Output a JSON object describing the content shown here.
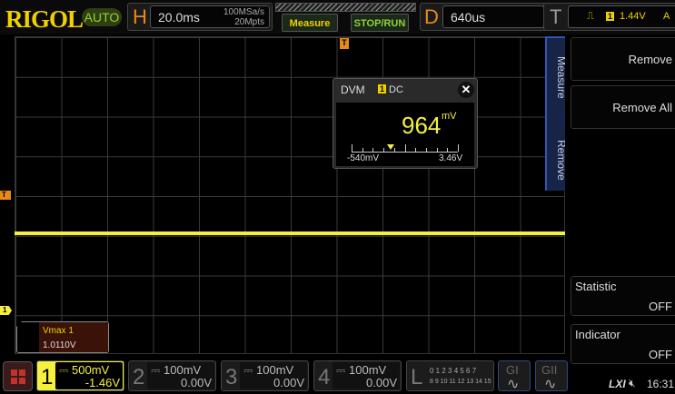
{
  "header": {
    "logo": "RIGOL",
    "mode": "AUTO",
    "h_label": "H",
    "timebase": "20.0ms",
    "sample_rate": "100MSa/s",
    "memory_depth": "20Mpts",
    "measure_button": "Measure",
    "stop_run_button": "STOP/RUN",
    "d_label": "D",
    "delay": "640us",
    "t_label": "T",
    "trigger_channel": "1",
    "trigger_level": "1.44V",
    "trigger_mode": "A"
  },
  "markers": {
    "trigger_pos": "T",
    "trigger_level": "T",
    "channel1": "1"
  },
  "dvm": {
    "title": "DVM",
    "channel": "1",
    "coupling": "DC",
    "value": "964",
    "unit": "mV",
    "scale_min": "-540mV",
    "scale_max": "3.46V",
    "pointer_fraction": 0.37
  },
  "measurement": {
    "label": "Vmax 1",
    "value": "1.0110V"
  },
  "side_menu": {
    "tab_measure": "Measure",
    "tab_remove": "Remove",
    "remove": "Remove",
    "remove_all": "Remove All",
    "statistic": "Statistic",
    "statistic_value": "OFF",
    "indicator": "Indicator",
    "indicator_value": "OFF"
  },
  "channels": [
    {
      "num": "1",
      "scale": "500mV",
      "offset": "-1.46V"
    },
    {
      "num": "2",
      "scale": "100mV",
      "offset": "0.00V"
    },
    {
      "num": "3",
      "scale": "100mV",
      "offset": "0.00V"
    },
    {
      "num": "4",
      "scale": "100mV",
      "offset": "0.00V"
    }
  ],
  "logic": {
    "label": "L",
    "row1": "0 1 2 3  4 5 6 7",
    "row2": "8 9 10 11 12 13 14 15"
  },
  "generators": [
    {
      "label": "GI"
    },
    {
      "label": "GII"
    }
  ],
  "status": {
    "lxi": "LXI",
    "time": "16:31"
  },
  "colors": {
    "ch1": "#f5f040",
    "accent": "#e88a1a"
  }
}
